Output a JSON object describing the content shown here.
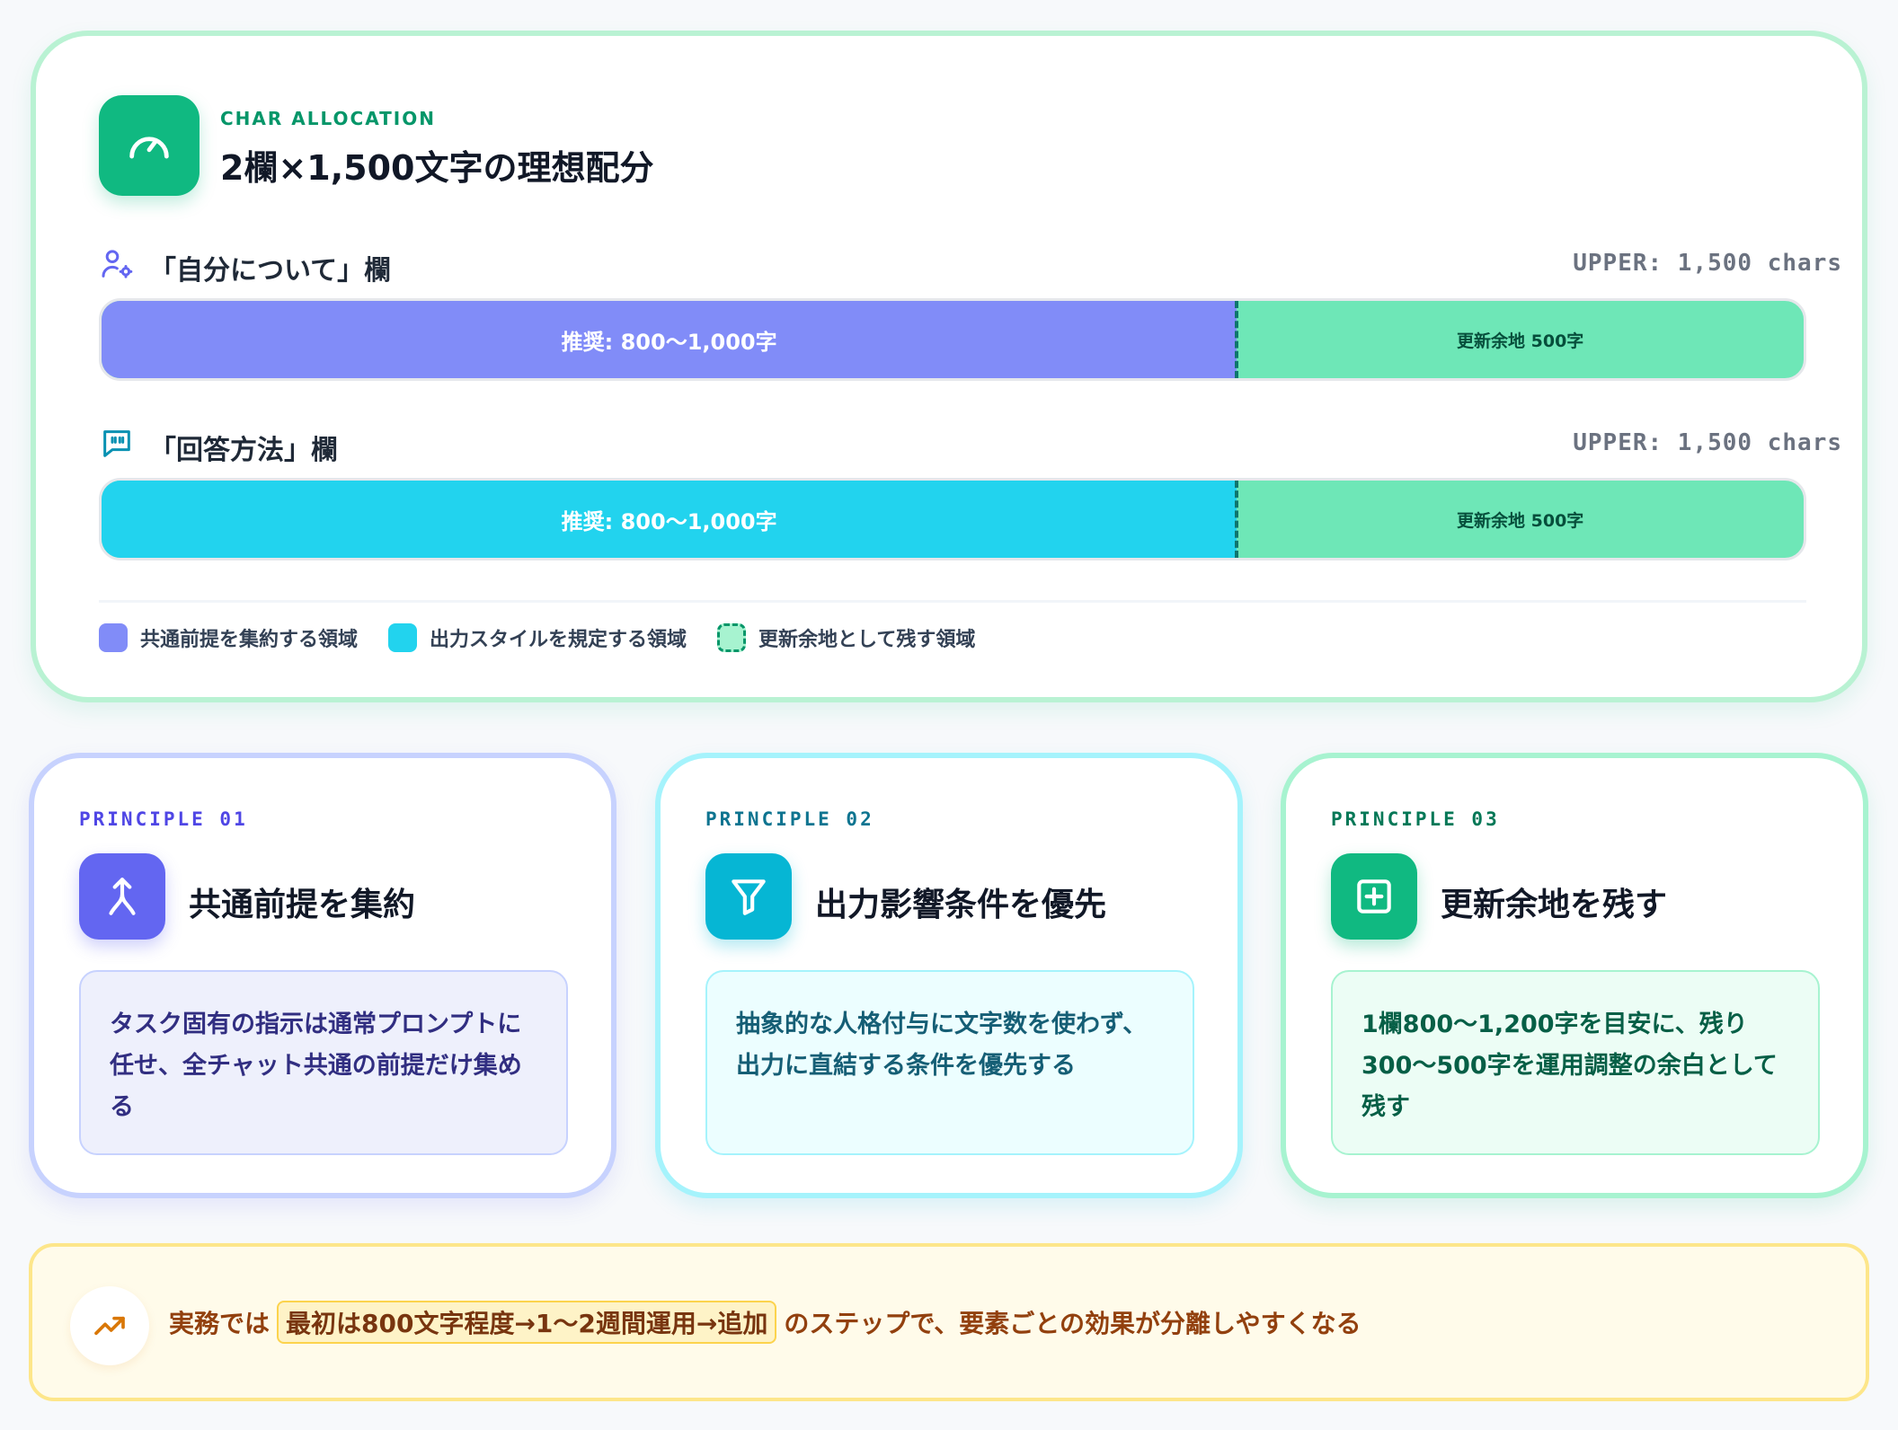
{
  "allocation": {
    "eyebrow": "CHAR ALLOCATION",
    "title": "2欄×1,500文字の理想配分",
    "icon": "gauge-icon",
    "rows": [
      {
        "label": "「自分について」欄",
        "icon": "user-settings-icon",
        "upper": "UPPER: 1,500 chars",
        "recommended_label": "推奨: 800〜1,000字",
        "remain_label": "更新余地 500字",
        "recommended_fraction": 0.667,
        "color": "#818cf8"
      },
      {
        "label": "「回答方法」欄",
        "icon": "quote-bubble-icon",
        "upper": "UPPER: 1,500 chars",
        "recommended_label": "推奨: 800〜1,000字",
        "remain_label": "更新余地 500字",
        "recommended_fraction": 0.667,
        "color": "#22d3ee"
      }
    ],
    "legend": [
      {
        "label": "共通前提を集約する領域",
        "color": "#818cf8"
      },
      {
        "label": "出力スタイルを規定する領域",
        "color": "#22d3ee"
      },
      {
        "label": "更新余地として残す領域",
        "color": "#a7f3d0"
      }
    ]
  },
  "principles": [
    {
      "eyebrow": "PRINCIPLE 01",
      "title": "共通前提を集約",
      "body": "タスク固有の指示は通常プロンプトに任せ、全チャット共通の前提だけ集める",
      "icon": "merge-icon",
      "accent": "#6366f1"
    },
    {
      "eyebrow": "PRINCIPLE 02",
      "title": "出力影響条件を優先",
      "body": "抽象的な人格付与に文字数を使わず、出力に直結する条件を優先する",
      "icon": "filter-icon",
      "accent": "#06b6d4"
    },
    {
      "eyebrow": "PRINCIPLE 03",
      "title": "更新余地を残す",
      "body": "1欄800〜1,200字を目安に、残り300〜500字を運用調整の余白として残す",
      "icon": "plus-square-icon",
      "accent": "#10b981"
    }
  ],
  "note": {
    "icon": "trending-up-icon",
    "prefix": "実務では",
    "highlight": "最初は800文字程度→1〜2週間運用→追加",
    "suffix": "のステップで、要素ごとの効果が分離しやすくなる"
  }
}
